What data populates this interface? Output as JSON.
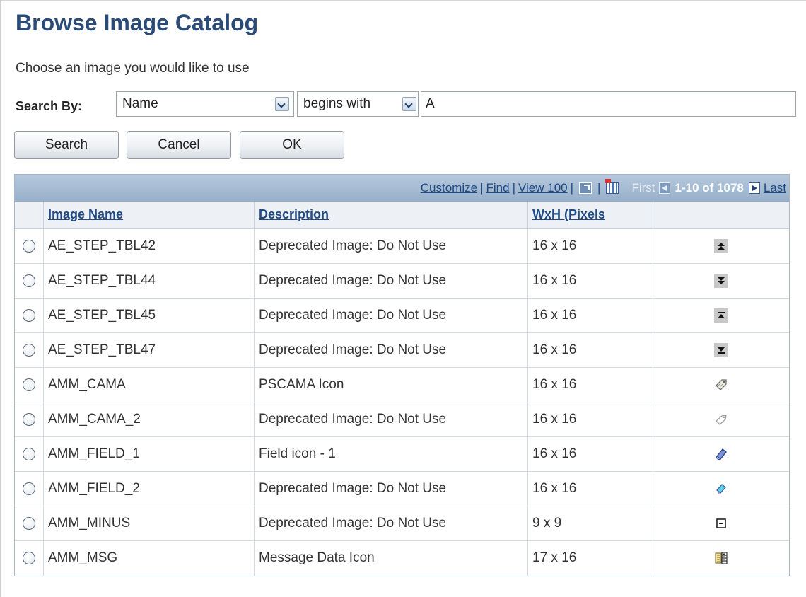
{
  "page": {
    "title": "Browse Image Catalog",
    "instructions": "Choose an image you would like to use"
  },
  "search": {
    "label": "Search By:",
    "field_value": "Name",
    "operator_value": "begins with",
    "text_value": "A"
  },
  "buttons": {
    "search": "Search",
    "cancel": "Cancel",
    "ok": "OK"
  },
  "grid": {
    "nav": {
      "customize": "Customize",
      "find": "Find",
      "view": "View 100",
      "first": "First",
      "range": "1-10 of 1078",
      "last": "Last"
    },
    "headers": {
      "name": "Image Name",
      "description": "Description",
      "size": "WxH (Pixels"
    },
    "rows": [
      {
        "name": "AE_STEP_TBL42",
        "description": "Deprecated Image: Do Not Use",
        "size": "16 x 16",
        "icon": "move-top-icon"
      },
      {
        "name": "AE_STEP_TBL44",
        "description": "Deprecated Image: Do Not Use",
        "size": "16 x 16",
        "icon": "move-bottom-icon"
      },
      {
        "name": "AE_STEP_TBL45",
        "description": "Deprecated Image: Do Not Use",
        "size": "16 x 16",
        "icon": "move-up-icon"
      },
      {
        "name": "AE_STEP_TBL47",
        "description": "Deprecated Image: Do Not Use",
        "size": "16 x 16",
        "icon": "move-down-icon"
      },
      {
        "name": "AMM_CAMA",
        "description": "PSCAMA Icon",
        "size": "16 x 16",
        "icon": "tag-icon"
      },
      {
        "name": "AMM_CAMA_2",
        "description": "Deprecated Image: Do Not Use",
        "size": "16 x 16",
        "icon": "tag-outline-icon"
      },
      {
        "name": "AMM_FIELD_1",
        "description": "Field icon - 1",
        "size": "16 x 16",
        "icon": "field-blue-icon"
      },
      {
        "name": "AMM_FIELD_2",
        "description": "Deprecated Image: Do Not Use",
        "size": "16 x 16",
        "icon": "field-cyan-icon"
      },
      {
        "name": "AMM_MINUS",
        "description": "Deprecated Image: Do Not Use",
        "size": "9 x 9",
        "icon": "minus-box-icon"
      },
      {
        "name": "AMM_MSG",
        "description": "Message Data Icon",
        "size": "17 x 16",
        "icon": "message-data-icon"
      }
    ]
  }
}
